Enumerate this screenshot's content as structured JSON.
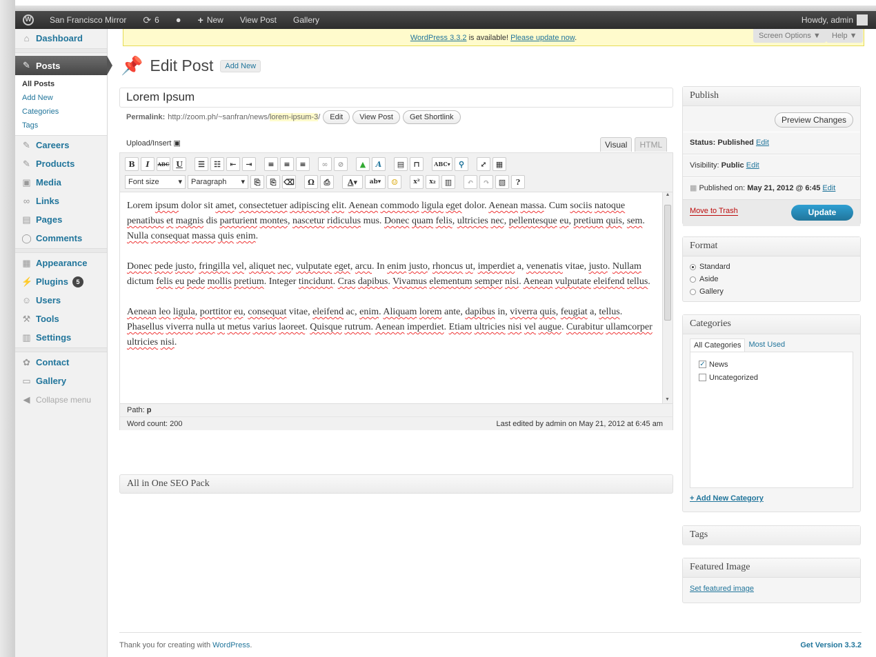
{
  "adminbar": {
    "site": "San Francisco Mirror",
    "updates": "6",
    "new": "New",
    "view_post": "View Post",
    "gallery": "Gallery",
    "howdy": "Howdy, admin"
  },
  "sidebar": {
    "dashboard": "Dashboard",
    "posts": "Posts",
    "sub": [
      "All Posts",
      "Add New",
      "Categories",
      "Tags"
    ],
    "careers": "Careers",
    "products": "Products",
    "media": "Media",
    "links": "Links",
    "pages": "Pages",
    "comments": "Comments",
    "appearance": "Appearance",
    "plugins": "Plugins",
    "plugins_badge": "5",
    "users": "Users",
    "tools": "Tools",
    "settings": "Settings",
    "contact": "Contact",
    "gallery": "Gallery",
    "collapse": "Collapse menu"
  },
  "notice": {
    "version_link": "WordPress 3.3.2",
    "text": " is available! ",
    "update_link": "Please update now",
    "dot": "."
  },
  "screen_options": "Screen Options ▼",
  "help": "Help ▼",
  "page": {
    "title": "Edit Post",
    "add_new": "Add New"
  },
  "post": {
    "title": "Lorem Ipsum",
    "permalink_label": "Permalink:",
    "permalink_base": "http://zoom.ph/~sanfran/news/",
    "permalink_slug": "lorem-ipsum-3",
    "permalink_end": "/",
    "btn_edit": "Edit",
    "btn_view": "View Post",
    "btn_shortlink": "Get Shortlink"
  },
  "editor": {
    "upload": "Upload/Insert",
    "tab_visual": "Visual",
    "tab_html": "HTML",
    "font_size": "Font size",
    "paragraph": "Paragraph",
    "path_label": "Path:",
    "path_value": "p",
    "word_count": "Word count: 200",
    "last_edited": "Last edited by admin on May 21, 2012 at 6:45 am"
  },
  "seo_box": "All in One SEO Pack",
  "publish": {
    "title": "Publish",
    "preview": "Preview Changes",
    "status_label": "Status:",
    "status": "Published",
    "visibility_label": "Visibility:",
    "visibility": "Public",
    "published_on": "Published on:",
    "date": "May 21, 2012 @ 6:45",
    "edit": "Edit",
    "trash": "Move to Trash",
    "update": "Update"
  },
  "format": {
    "title": "Format",
    "options": [
      "Standard",
      "Aside",
      "Gallery"
    ],
    "selected": "Standard"
  },
  "categories": {
    "title": "Categories",
    "tab_all": "All Categories",
    "tab_used": "Most Used",
    "items": [
      "News",
      "Uncategorized"
    ],
    "checked": [
      "News"
    ],
    "add": "+ Add New Category"
  },
  "tags": {
    "title": "Tags"
  },
  "featured": {
    "title": "Featured Image",
    "link": "Set featured image"
  },
  "footer": {
    "thanks": "Thank you for creating with ",
    "wp": "WordPress",
    "dot": ".",
    "version": "Get Version 3.3.2"
  }
}
